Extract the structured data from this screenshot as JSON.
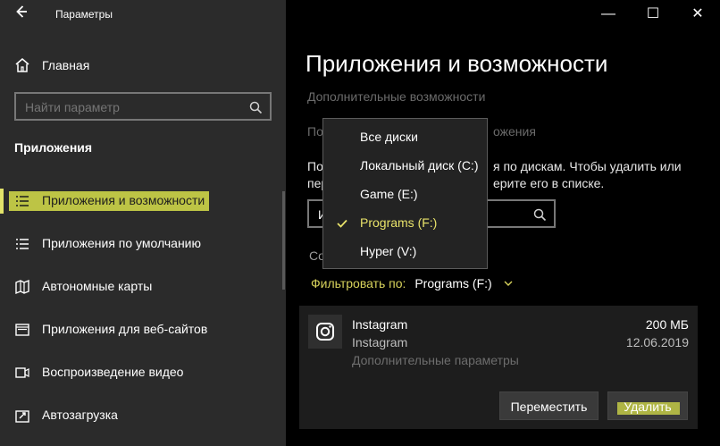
{
  "window": {
    "app_title": "Параметры",
    "controls": {
      "minimize": "—",
      "maximize": "☐",
      "close": "✕"
    }
  },
  "sidebar": {
    "home_label": "Главная",
    "search_placeholder": "Найти параметр",
    "section_title": "Приложения",
    "items": [
      {
        "label": "Приложения и возможности"
      },
      {
        "label": "Приложения по умолчанию"
      },
      {
        "label": "Автономные карты"
      },
      {
        "label": "Приложения для веб-сайтов"
      },
      {
        "label": "Воспроизведение видео"
      },
      {
        "label": "Автозагрузка"
      }
    ]
  },
  "main": {
    "title": "Приложения и возможности",
    "link_optional_features": "Дополнительные возможности",
    "link2_left": "По",
    "link2_right": "ожения",
    "desc1_left": "По",
    "desc1_right": "я по дискам. Чтобы удалить или",
    "desc2_left": "пер",
    "desc2_right": "ерите его в списке.",
    "search_value": "И",
    "sort_partial": "Со",
    "filter_label": "Фильтровать по:",
    "filter_value": "Programs (F:)"
  },
  "dropdown": {
    "items": [
      {
        "label": "Все диски",
        "selected": false
      },
      {
        "label": "Локальный диск (C:)",
        "selected": false
      },
      {
        "label": "Game (E:)",
        "selected": false
      },
      {
        "label": "Programs (F:)",
        "selected": true
      },
      {
        "label": "Hyper (V:)",
        "selected": false
      }
    ]
  },
  "app_card": {
    "name": "Instagram",
    "publisher": "Instagram",
    "advanced": "Дополнительные параметры",
    "size": "200 МБ",
    "date": "12.06.2019",
    "move_button": "Переместить",
    "delete_button": "Удалить"
  },
  "colors": {
    "highlight": "#d7df4a",
    "filter_accent": "#d8d35c",
    "left_bg": "#2b2b2b",
    "right_bg": "#000000"
  }
}
